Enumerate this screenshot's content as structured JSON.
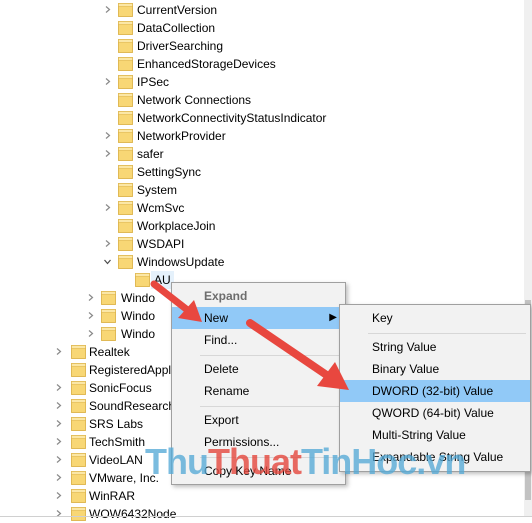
{
  "tree": {
    "items": [
      {
        "label": "CurrentVersion",
        "level": 1,
        "arrow": "right"
      },
      {
        "label": "DataCollection",
        "level": 1,
        "arrow": "none"
      },
      {
        "label": "DriverSearching",
        "level": 1,
        "arrow": "none"
      },
      {
        "label": "EnhancedStorageDevices",
        "level": 1,
        "arrow": "none"
      },
      {
        "label": "IPSec",
        "level": 1,
        "arrow": "right"
      },
      {
        "label": "Network Connections",
        "level": 1,
        "arrow": "none"
      },
      {
        "label": "NetworkConnectivityStatusIndicator",
        "level": 1,
        "arrow": "none"
      },
      {
        "label": "NetworkProvider",
        "level": 1,
        "arrow": "right"
      },
      {
        "label": "safer",
        "level": 1,
        "arrow": "right"
      },
      {
        "label": "SettingSync",
        "level": 1,
        "arrow": "none"
      },
      {
        "label": "System",
        "level": 1,
        "arrow": "none"
      },
      {
        "label": "WcmSvc",
        "level": 1,
        "arrow": "right"
      },
      {
        "label": "WorkplaceJoin",
        "level": 1,
        "arrow": "none"
      },
      {
        "label": "WSDAPI",
        "level": 1,
        "arrow": "right"
      },
      {
        "label": "WindowsUpdate",
        "level": 1,
        "arrow": "down"
      },
      {
        "label": "AU",
        "level": 2,
        "arrow": "none",
        "selected": true
      },
      {
        "label": "Windo",
        "level": 0,
        "arrow": "right"
      },
      {
        "label": "Windo",
        "level": 0,
        "arrow": "right"
      },
      {
        "label": "Windo",
        "level": 0,
        "arrow": "right"
      },
      {
        "label": "Realtek",
        "level": -1,
        "arrow": "right"
      },
      {
        "label": "RegisteredAppl",
        "level": -1,
        "arrow": "none"
      },
      {
        "label": "SonicFocus",
        "level": -1,
        "arrow": "right"
      },
      {
        "label": "SoundResearch",
        "level": -1,
        "arrow": "right"
      },
      {
        "label": "SRS Labs",
        "level": -1,
        "arrow": "right"
      },
      {
        "label": "TechSmith",
        "level": -1,
        "arrow": "right"
      },
      {
        "label": "VideoLAN",
        "level": -1,
        "arrow": "right"
      },
      {
        "label": "VMware, Inc.",
        "level": -1,
        "arrow": "right"
      },
      {
        "label": "WinRAR",
        "level": -1,
        "arrow": "right"
      },
      {
        "label": "WOW6432Node",
        "level": -1,
        "arrow": "right"
      }
    ]
  },
  "context_menu": {
    "items": [
      {
        "label": "Expand",
        "style": "bold"
      },
      {
        "label": "New",
        "style": "highlight",
        "submenu": true
      },
      {
        "label": "Find...",
        "style": "normal"
      },
      {
        "label": "Delete",
        "style": "normal"
      },
      {
        "label": "Rename",
        "style": "normal"
      },
      {
        "label": "Export",
        "style": "normal"
      },
      {
        "label": "Permissions...",
        "style": "normal"
      },
      {
        "label": "Copy Key Name",
        "style": "normal"
      }
    ]
  },
  "submenu": {
    "items": [
      {
        "label": "Key",
        "style": "normal"
      },
      {
        "label": "String Value",
        "style": "normal"
      },
      {
        "label": "Binary Value",
        "style": "normal"
      },
      {
        "label": "DWORD (32-bit) Value",
        "style": "highlight"
      },
      {
        "label": "QWORD (64-bit) Value",
        "style": "normal"
      },
      {
        "label": "Multi-String Value",
        "style": "normal"
      },
      {
        "label": "Expandable String Value",
        "style": "normal"
      }
    ]
  },
  "watermark": {
    "part1": "Thu",
    "part2": "Thuat",
    "part3": "TinHoc.vn"
  },
  "colors": {
    "folder": "#f8d775",
    "folder_edge": "#d9ad3c",
    "highlight": "#91c9f7",
    "arrow_annotation": "#e8473f"
  }
}
